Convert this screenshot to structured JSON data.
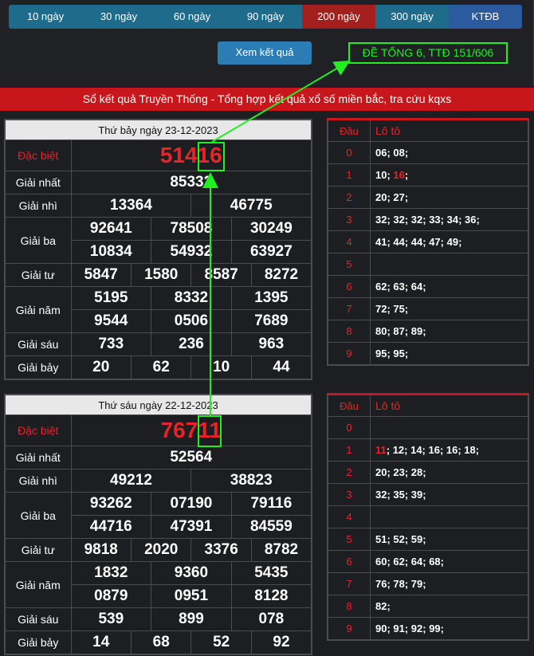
{
  "tabs": [
    {
      "label": "10 ngày"
    },
    {
      "label": "30 ngày"
    },
    {
      "label": "60 ngày"
    },
    {
      "label": "90 ngày"
    },
    {
      "label": "200 ngày"
    },
    {
      "label": "300 ngày"
    },
    {
      "label": "KTĐB"
    }
  ],
  "active_tab": "200 ngày",
  "xem_button": "Xem kết quả",
  "de_tong": "ĐỀ TỔNG 6, TTĐ 151/606",
  "banner": "Sổ kết quả Truyền Thống - Tổng hợp kết quả xổ số miền bắc, tra cứu kqxs",
  "labels": {
    "dac_biet": "Đặc biệt",
    "nhat": "Giải nhất",
    "nhi": "Giải nhì",
    "ba": "Giải ba",
    "tu": "Giải tư",
    "nam": "Giải năm",
    "sau": "Giải sáu",
    "bay": "Giải bảy",
    "dau": "Đầu",
    "loto": "Lô tô"
  },
  "draws": [
    {
      "date": "Thứ bảy ngày 23-12-2023",
      "dac_biet": "51416",
      "nhat": "85332",
      "nhi": [
        "13364",
        "46775"
      ],
      "ba": [
        "92641",
        "78508",
        "30249",
        "10834",
        "54932",
        "63927"
      ],
      "tu": [
        "5847",
        "1580",
        "8587",
        "8272"
      ],
      "nam": [
        "5195",
        "8332",
        "1395",
        "9544",
        "0506",
        "7689"
      ],
      "sau": [
        "733",
        "236",
        "963"
      ],
      "bay": [
        "20",
        "62",
        "10",
        "44"
      ],
      "loto": [
        {
          "dau": "0",
          "vals": "06; 08;"
        },
        {
          "dau": "1",
          "vals": "10; ",
          "hl": "16",
          "rest": ";"
        },
        {
          "dau": "2",
          "vals": "20; 27;"
        },
        {
          "dau": "3",
          "vals": "32; 32; 32; 33; 34; 36;"
        },
        {
          "dau": "4",
          "vals": "41; 44; 44; 47; 49;"
        },
        {
          "dau": "5",
          "vals": ""
        },
        {
          "dau": "6",
          "vals": "62; 63; 64;"
        },
        {
          "dau": "7",
          "vals": "72; 75;"
        },
        {
          "dau": "8",
          "vals": "80; 87; 89;"
        },
        {
          "dau": "9",
          "vals": "95; 95;"
        }
      ]
    },
    {
      "date": "Thứ sáu ngày 22-12-2023",
      "dac_biet": "76711",
      "nhat": "52564",
      "nhi": [
        "49212",
        "38823"
      ],
      "ba": [
        "93262",
        "07190",
        "79116",
        "44716",
        "47391",
        "84559"
      ],
      "tu": [
        "9818",
        "2020",
        "3376",
        "8782"
      ],
      "nam": [
        "1832",
        "9360",
        "5435",
        "0879",
        "0951",
        "8128"
      ],
      "sau": [
        "539",
        "899",
        "078"
      ],
      "bay": [
        "14",
        "68",
        "52",
        "92"
      ],
      "loto": [
        {
          "dau": "0",
          "vals": ""
        },
        {
          "dau": "1",
          "hl": "11",
          "rest": "; 12; 14; 16; 16; 18;",
          "vals": ""
        },
        {
          "dau": "2",
          "vals": "20; 23; 28;"
        },
        {
          "dau": "3",
          "vals": "32; 35; 39;"
        },
        {
          "dau": "4",
          "vals": ""
        },
        {
          "dau": "5",
          "vals": "51; 52; 59;"
        },
        {
          "dau": "6",
          "vals": "60; 62; 64; 68;"
        },
        {
          "dau": "7",
          "vals": "76; 78; 79;"
        },
        {
          "dau": "8",
          "vals": "82;"
        },
        {
          "dau": "9",
          "vals": "90; 91; 92; 99;"
        }
      ]
    }
  ]
}
